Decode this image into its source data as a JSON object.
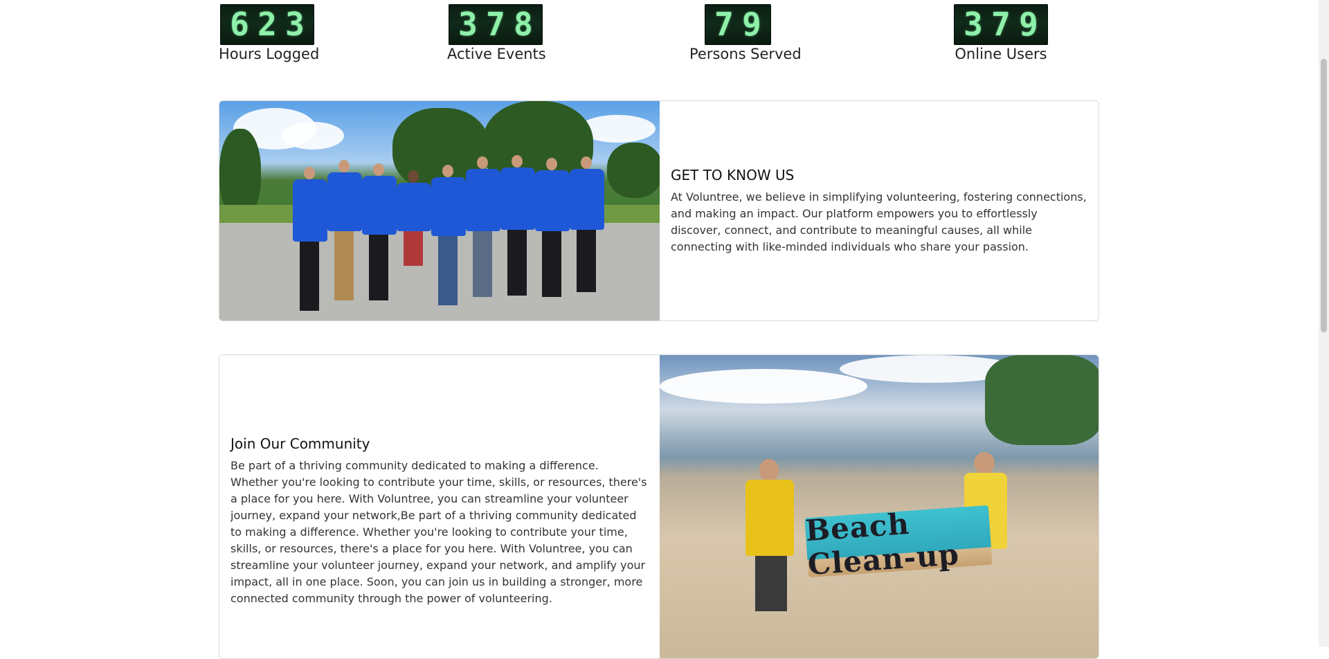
{
  "stats": [
    {
      "digits": [
        "6",
        "2",
        "3"
      ],
      "label": "Hours Logged"
    },
    {
      "digits": [
        "3",
        "7",
        "8"
      ],
      "label": "Active Events"
    },
    {
      "digits": [
        "7",
        "9"
      ],
      "label": "Persons Served"
    },
    {
      "digits": [
        "3",
        "7",
        "9"
      ],
      "label": "Online Users"
    }
  ],
  "about": {
    "heading": "GET TO KNOW US",
    "body": "At Voluntree, we believe in simplifying volunteering, fostering connections, and making an impact. Our platform empowers you to effortlessly discover, connect, and contribute to meaningful causes, all while connecting with like-minded individuals who share your passion."
  },
  "community": {
    "heading": "Join Our Community",
    "body": "Be part of a thriving community dedicated to making a difference. Whether you're looking to contribute your time, skills, or resources, there's a place for you here. With Voluntree, you can streamline your volunteer journey, expand your network,Be part of a thriving community dedicated to making a difference. Whether you're looking to contribute your time, skills, or resources, there's a place for you here. With Voluntree, you can streamline your volunteer journey, expand your network, and amplify your impact, all in one place. Soon, you can join us in building a stronger, more connected community through the power of volunteering.",
    "photo_sign_text": "Beach Clean-up"
  },
  "colors": {
    "counter_bg": "#0c1c12",
    "counter_digit": "#8ff0a9",
    "card_border": "#d8d8d8"
  }
}
